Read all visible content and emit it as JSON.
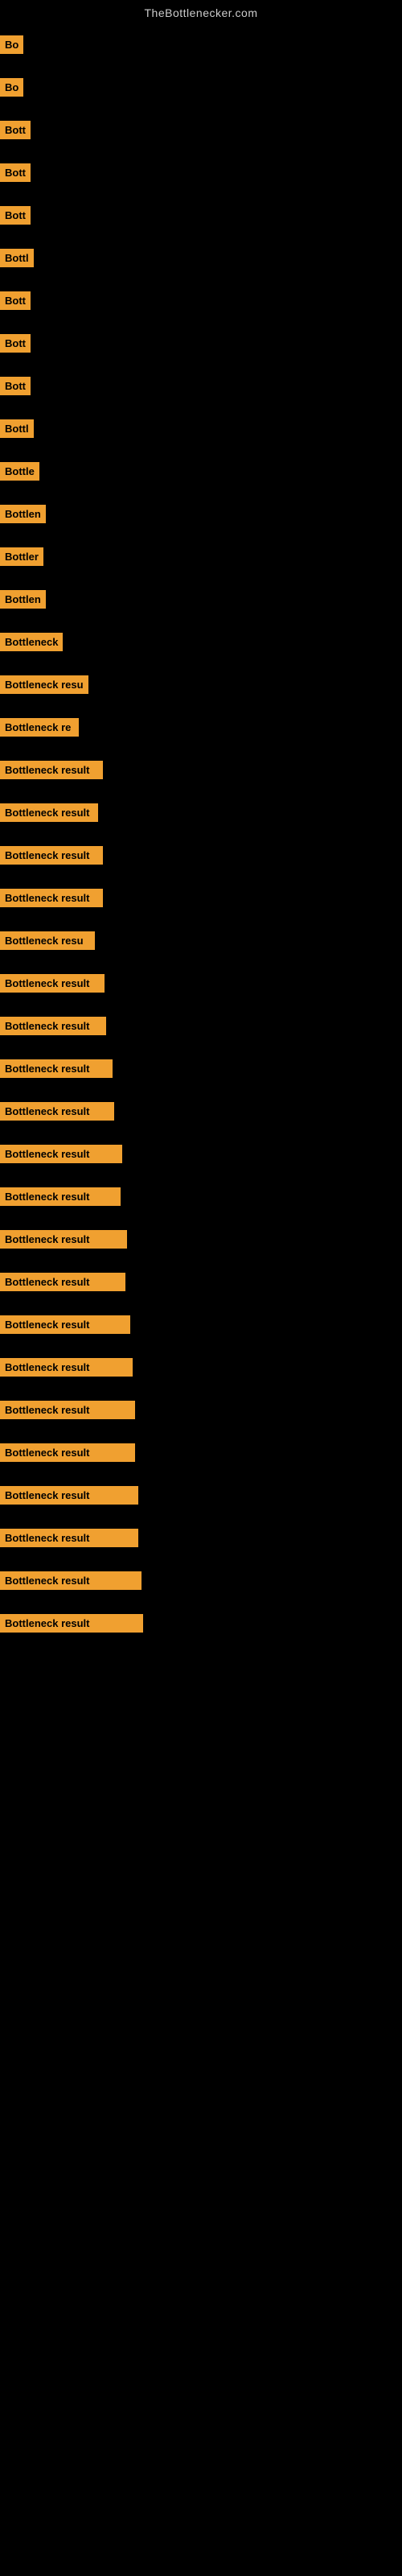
{
  "site": {
    "title": "TheBottlenecker.com"
  },
  "items": [
    {
      "label": "Bo",
      "width": 22
    },
    {
      "label": "Bo",
      "width": 22
    },
    {
      "label": "Bott",
      "width": 32
    },
    {
      "label": "Bott",
      "width": 34
    },
    {
      "label": "Bott",
      "width": 34
    },
    {
      "label": "Bottl",
      "width": 38
    },
    {
      "label": "Bott",
      "width": 36
    },
    {
      "label": "Bott",
      "width": 36
    },
    {
      "label": "Bott",
      "width": 38
    },
    {
      "label": "Bottl",
      "width": 42
    },
    {
      "label": "Bottle",
      "width": 46
    },
    {
      "label": "Bottlen",
      "width": 56
    },
    {
      "label": "Bottler",
      "width": 54
    },
    {
      "label": "Bottlen",
      "width": 56
    },
    {
      "label": "Bottleneck",
      "width": 76
    },
    {
      "label": "Bottleneck resu",
      "width": 110
    },
    {
      "label": "Bottleneck re",
      "width": 98
    },
    {
      "label": "Bottleneck result",
      "width": 128
    },
    {
      "label": "Bottleneck result",
      "width": 122
    },
    {
      "label": "Bottleneck result",
      "width": 128
    },
    {
      "label": "Bottleneck result",
      "width": 128
    },
    {
      "label": "Bottleneck resu",
      "width": 118
    },
    {
      "label": "Bottleneck result",
      "width": 130
    },
    {
      "label": "Bottleneck result",
      "width": 132
    },
    {
      "label": "Bottleneck result",
      "width": 140
    },
    {
      "label": "Bottleneck result",
      "width": 142
    },
    {
      "label": "Bottleneck result",
      "width": 152
    },
    {
      "label": "Bottleneck result",
      "width": 150
    },
    {
      "label": "Bottleneck result",
      "width": 158
    },
    {
      "label": "Bottleneck result",
      "width": 156
    },
    {
      "label": "Bottleneck result",
      "width": 162
    },
    {
      "label": "Bottleneck result",
      "width": 165
    },
    {
      "label": "Bottleneck result",
      "width": 168
    },
    {
      "label": "Bottleneck result",
      "width": 168
    },
    {
      "label": "Bottleneck result",
      "width": 172
    },
    {
      "label": "Bottleneck result",
      "width": 172
    },
    {
      "label": "Bottleneck result",
      "width": 176
    },
    {
      "label": "Bottleneck result",
      "width": 178
    }
  ]
}
